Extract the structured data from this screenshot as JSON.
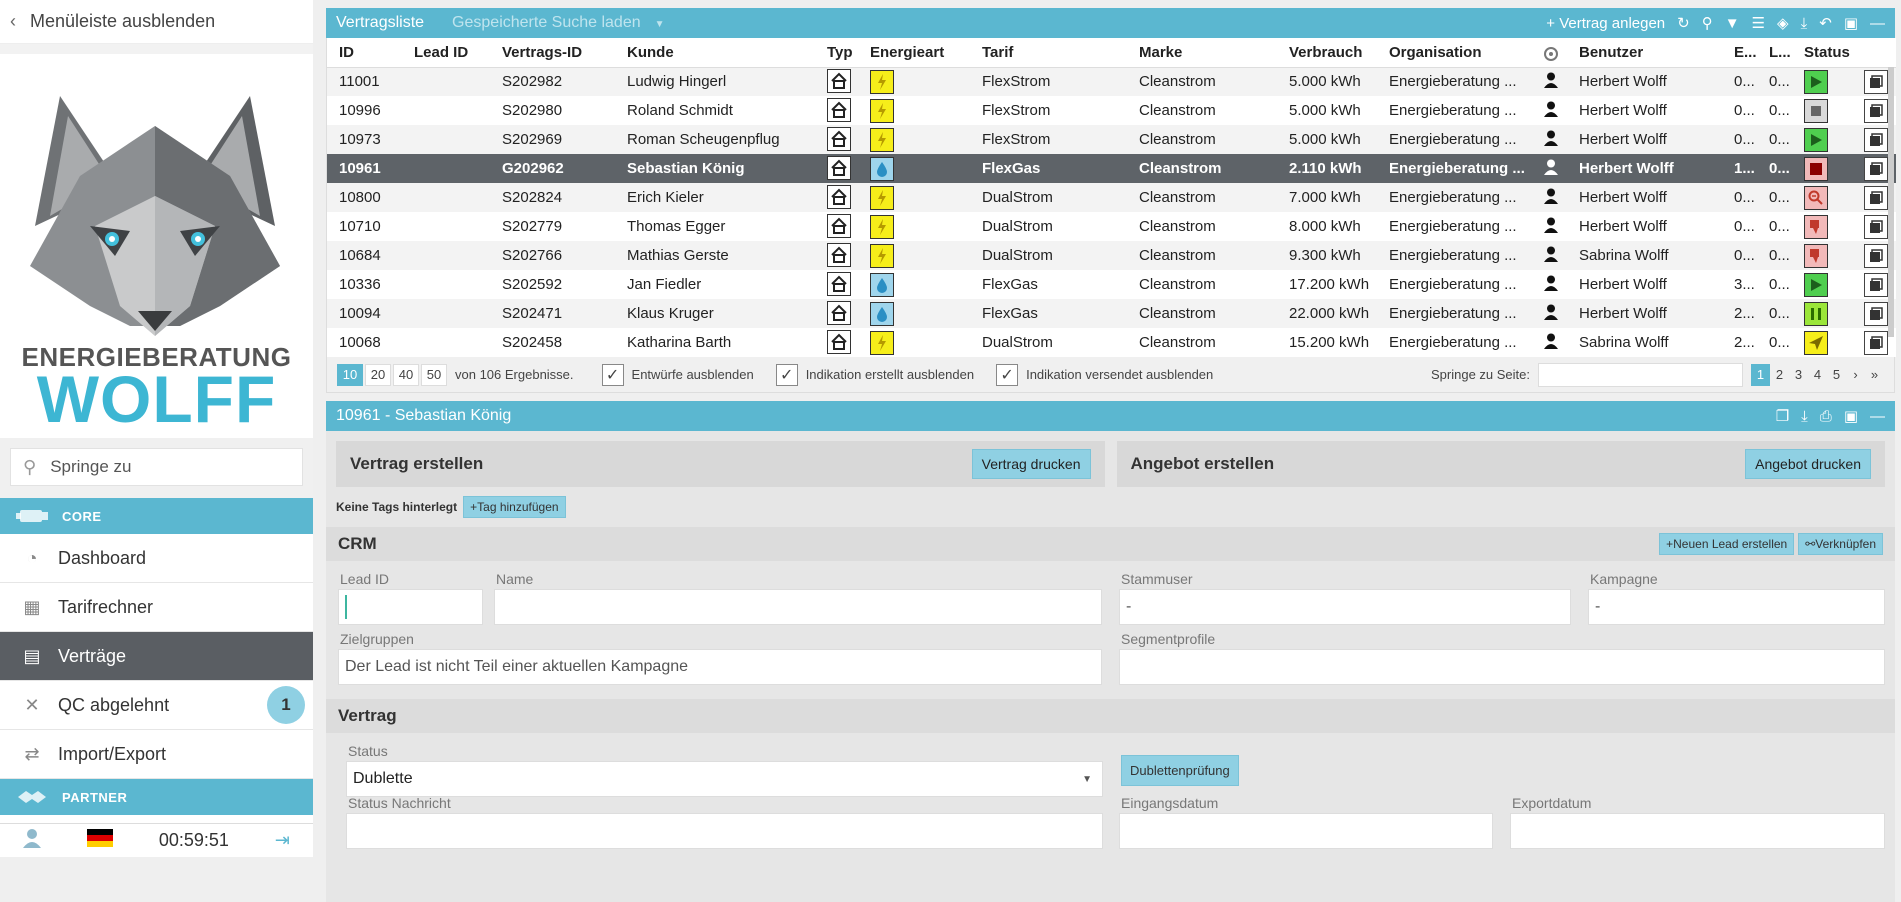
{
  "sidebar": {
    "hide_menu": "Menüleiste ausblenden",
    "brand_line1": "ENERGIEBERATUNG",
    "brand_line2": "WOLFF",
    "search_placeholder": "Springe zu",
    "core_label": "CORE",
    "partner_label": "PARTNER",
    "items": [
      {
        "label": "Dashboard"
      },
      {
        "label": "Tarifrechner"
      },
      {
        "label": "Verträge"
      },
      {
        "label": "QC abgelehnt",
        "badge": "1"
      },
      {
        "label": "Import/Export"
      }
    ],
    "timer": "00:59:51"
  },
  "list": {
    "title": "Vertragsliste",
    "saved_search": "Gespeicherte Suche laden",
    "new_contract": "Vertrag anlegen",
    "columns": [
      "ID",
      "Lead ID",
      "Vertrags-ID",
      "Kunde",
      "Typ",
      "Energieart",
      "Tarif",
      "Marke",
      "Verbrauch",
      "Organisation",
      "",
      "Benutzer",
      "E...",
      "L...",
      "Status"
    ],
    "rows": [
      {
        "id": "11001",
        "lead": "",
        "vid": "S202982",
        "kunde": "Ludwig Hingerl",
        "energie": "strom",
        "tarif": "FlexStrom",
        "marke": "Cleanstrom",
        "verbrauch": "5.000 kWh",
        "org": "Energieberatung ...",
        "user": "Herbert Wolff",
        "e": "0...",
        "l": "0...",
        "status": "play"
      },
      {
        "id": "10996",
        "lead": "",
        "vid": "S202980",
        "kunde": "Roland Schmidt",
        "energie": "strom",
        "tarif": "FlexStrom",
        "marke": "Cleanstrom",
        "verbrauch": "5.000 kWh",
        "org": "Energieberatung ...",
        "user": "Herbert Wolff",
        "e": "0...",
        "l": "0...",
        "status": "stop"
      },
      {
        "id": "10973",
        "lead": "",
        "vid": "S202969",
        "kunde": "Roman Scheugenpflug",
        "energie": "strom",
        "tarif": "FlexStrom",
        "marke": "Cleanstrom",
        "verbrauch": "5.000 kWh",
        "org": "Energieberatung ...",
        "user": "Herbert Wolff",
        "e": "0...",
        "l": "0...",
        "status": "play"
      },
      {
        "id": "10961",
        "lead": "",
        "vid": "G202962",
        "kunde": "Sebastian König",
        "energie": "gas",
        "tarif": "FlexGas",
        "marke": "Cleanstrom",
        "verbrauch": "2.110 kWh",
        "org": "Energieberatung ...",
        "user": "Herbert Wolff",
        "e": "1...",
        "l": "0...",
        "status": "redstop",
        "selected": true
      },
      {
        "id": "10800",
        "lead": "",
        "vid": "S202824",
        "kunde": "Erich Kieler",
        "energie": "strom",
        "tarif": "DualStrom",
        "marke": "Cleanstrom",
        "verbrauch": "7.000 kWh",
        "org": "Energieberatung ...",
        "user": "Herbert Wolff",
        "e": "0...",
        "l": "0...",
        "status": "search"
      },
      {
        "id": "10710",
        "lead": "",
        "vid": "S202779",
        "kunde": "Thomas Egger",
        "energie": "strom",
        "tarif": "DualStrom",
        "marke": "Cleanstrom",
        "verbrauch": "8.000 kWh",
        "org": "Energieberatung ...",
        "user": "Herbert Wolff",
        "e": "0...",
        "l": "0...",
        "status": "thumb"
      },
      {
        "id": "10684",
        "lead": "",
        "vid": "S202766",
        "kunde": "Mathias Gerste",
        "energie": "strom",
        "tarif": "DualStrom",
        "marke": "Cleanstrom",
        "verbrauch": "9.300 kWh",
        "org": "Energieberatung ...",
        "user": "Sabrina Wolff",
        "e": "0...",
        "l": "0...",
        "status": "thumb"
      },
      {
        "id": "10336",
        "lead": "",
        "vid": "S202592",
        "kunde": "Jan Fiedler",
        "energie": "gas",
        "tarif": "FlexGas",
        "marke": "Cleanstrom",
        "verbrauch": "17.200 kWh",
        "org": "Energieberatung ...",
        "user": "Herbert Wolff",
        "e": "3...",
        "l": "0...",
        "status": "play"
      },
      {
        "id": "10094",
        "lead": "",
        "vid": "S202471",
        "kunde": "Klaus Kruger",
        "energie": "gas",
        "tarif": "FlexGas",
        "marke": "Cleanstrom",
        "verbrauch": "22.000 kWh",
        "org": "Energieberatung ...",
        "user": "Herbert Wolff",
        "e": "2...",
        "l": "0...",
        "status": "pause"
      },
      {
        "id": "10068",
        "lead": "",
        "vid": "S202458",
        "kunde": "Katharina Barth",
        "energie": "strom",
        "tarif": "DualStrom",
        "marke": "Cleanstrom",
        "verbrauch": "15.200 kWh",
        "org": "Energieberatung ...",
        "user": "Sabrina Wolff",
        "e": "2...",
        "l": "0...",
        "status": "send"
      }
    ],
    "page_sizes": [
      "10",
      "20",
      "40",
      "50"
    ],
    "results_text": "von 106 Ergebnisse.",
    "cb1": "Entwürfe ausblenden",
    "cb2": "Indikation erstellt ausblenden",
    "cb3": "Indikation versendet ausblenden",
    "jump_label": "Springe zu Seite:",
    "pages": [
      "1",
      "2",
      "3",
      "4",
      "5"
    ]
  },
  "detail": {
    "title": "10961 - Sebastian König",
    "create_contract": "Vertrag erstellen",
    "print_contract": "Vertrag drucken",
    "create_offer": "Angebot erstellen",
    "print_offer": "Angebot drucken",
    "no_tags": "Keine Tags hinterlegt",
    "add_tag": "Tag hinzufügen",
    "crm": "CRM",
    "new_lead": "Neuen Lead erstellen",
    "link": "Verknüpfen",
    "lead_id_label": "Lead ID",
    "name_label": "Name",
    "stammuser_label": "Stammuser",
    "stammuser_value": "-",
    "kampagne_label": "Kampagne",
    "kampagne_value": "-",
    "zielgruppen_label": "Zielgruppen",
    "zielgruppen_value": "Der Lead ist nicht Teil einer aktuellen Kampagne",
    "segment_label": "Segmentprofile",
    "vertrag": "Vertrag",
    "status_label": "Status",
    "status_value": "Dublette",
    "dup_check": "Dublettenprüfung",
    "status_msg_label": "Status Nachricht",
    "eingang_label": "Eingangsdatum",
    "export_label": "Exportdatum"
  },
  "colors": {
    "accent": "#5bb7d0",
    "selected_row": "#5e6368",
    "strom": "#f6ee1a",
    "gas": "#9fd5ec"
  }
}
